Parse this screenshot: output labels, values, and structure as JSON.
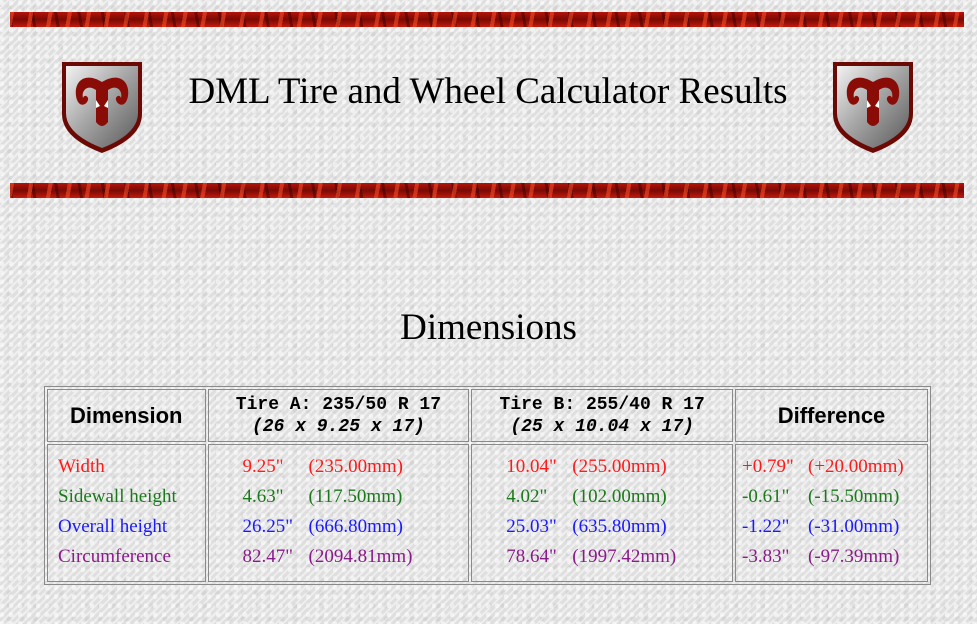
{
  "header": {
    "title": "DML Tire and Wheel Calculator Results"
  },
  "section": {
    "title": "Dimensions"
  },
  "table": {
    "headers": {
      "dimension": "Dimension",
      "tire_a_line1": "Tire A: 235/50 R 17",
      "tire_a_line2": "(26 x 9.25 x 17)",
      "tire_b_line1": "Tire B: 255/40 R 17",
      "tire_b_line2": "(25 x 10.04 x 17)",
      "difference": "Difference"
    },
    "rows": [
      {
        "label": "Width",
        "a_in": "9.25\"",
        "a_mm": "(235.00mm)",
        "b_in": "10.04\"",
        "b_mm": "(255.00mm)",
        "d_in": "+0.79\"",
        "d_mm": "(+20.00mm)",
        "color": "#ff1a1a"
      },
      {
        "label": "Sidewall height",
        "a_in": "4.63\"",
        "a_mm": "(117.50mm)",
        "b_in": "4.02\"",
        "b_mm": "(102.00mm)",
        "d_in": "-0.61\"",
        "d_mm": "(-15.50mm)",
        "color": "#1a7a1a"
      },
      {
        "label": "Overall height",
        "a_in": "26.25\"",
        "a_mm": "(666.80mm)",
        "b_in": "25.03\"",
        "b_mm": "(635.80mm)",
        "d_in": "-1.22\"",
        "d_mm": "(-31.00mm)",
        "color": "#1a1aff"
      },
      {
        "label": "Circumference",
        "a_in": "82.47\"",
        "a_mm": "(2094.81mm)",
        "b_in": "78.64\"",
        "b_mm": "(1997.42mm)",
        "d_in": "-3.83\"",
        "d_mm": "(-97.39mm)",
        "color": "#8a1a8a"
      }
    ]
  },
  "colors": {
    "banner_red": "#b3140a",
    "width": "#ff1a1a",
    "sidewall": "#1a7a1a",
    "overall": "#1a1aff",
    "circumference": "#8a1a8a"
  },
  "icons": {
    "logo_left": "ram-head-shield-icon",
    "logo_right": "ram-head-shield-icon"
  }
}
